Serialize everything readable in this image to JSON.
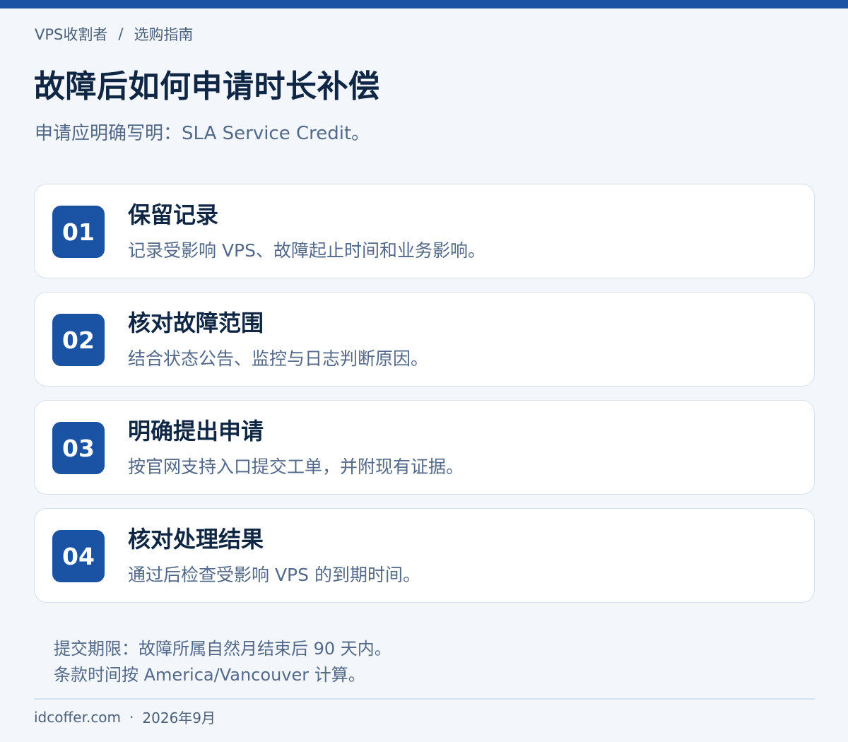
{
  "breadcrumb": {
    "home": "VPS收割者",
    "separator": "/",
    "current": "选购指南"
  },
  "page": {
    "title": "故障后如何申请时长补偿",
    "subtitle": "申请应明确写明：SLA Service Credit。"
  },
  "steps": [
    {
      "number": "01",
      "title": "保留记录",
      "description": "记录受影响 VPS、故障起止时间和业务影响。"
    },
    {
      "number": "02",
      "title": "核对故障范围",
      "description": "结合状态公告、监控与日志判断原因。"
    },
    {
      "number": "03",
      "title": "明确提出申请",
      "description": "按官网支持入口提交工单，并附现有证据。"
    },
    {
      "number": "04",
      "title": "核对处理结果",
      "description": "通过后检查受影响 VPS 的到期时间。"
    }
  ],
  "notes": {
    "deadline": "提交期限：故障所属自然月结束后 90 天内。",
    "timezone": "条款时间按 America/Vancouver 计算。"
  },
  "footer": {
    "site": "idcoffer.com",
    "separator": "·",
    "date": "2026年9月"
  },
  "colors": {
    "accent": "#1a53a4",
    "background": "#f3f7fb",
    "card": "#ffffff",
    "title_text": "#0f2745",
    "body_text": "#53698a"
  }
}
